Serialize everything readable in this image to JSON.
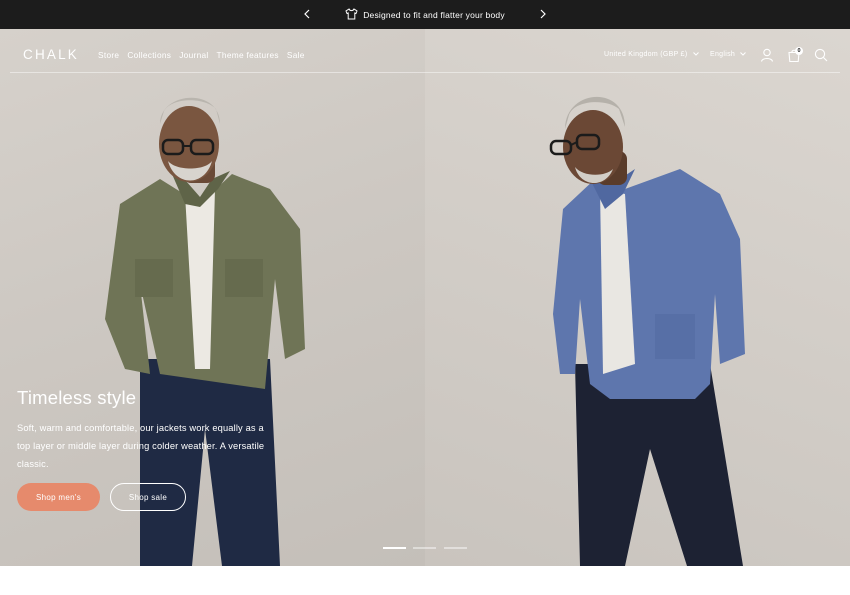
{
  "announcement": {
    "message": "Designed to fit and flatter your body",
    "icon": "tshirt-icon",
    "prev_icon": "chevron-left-icon",
    "next_icon": "chevron-right-icon"
  },
  "header": {
    "logo": "CHALK",
    "nav": [
      "Store",
      "Collections",
      "Journal",
      "Theme features",
      "Sale"
    ],
    "country_selector": "United Kingdom (GBP £)",
    "language_selector": "English",
    "cart_count": "0",
    "icons": [
      "account-icon",
      "cart-icon",
      "search-icon"
    ]
  },
  "hero": {
    "title": "Timeless style",
    "body": "Soft, warm and comfortable, our jackets work equally as a top layer or middle layer during colder weather. A versatile classic.",
    "primary_button": "Shop men's",
    "secondary_button": "Shop sale",
    "slides": 3,
    "active_slide": 1
  },
  "colors": {
    "announcement_bg": "#1c1c1c",
    "primary_button": "#e68a6c",
    "hero_bg": "#d1ccc6"
  }
}
